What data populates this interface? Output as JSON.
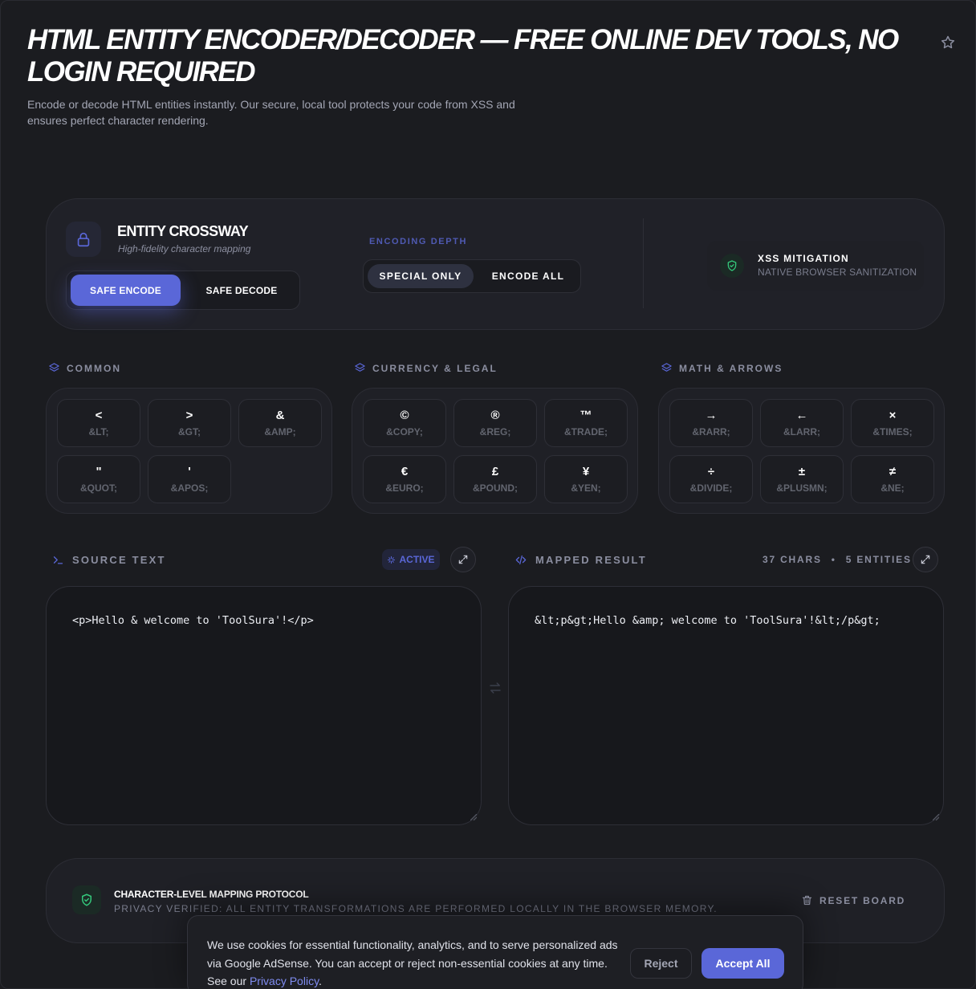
{
  "header": {
    "title": "HTML ENTITY ENCODER/DECODER — FREE ONLINE DEV TOOLS, NO LOGIN REQUIRED",
    "subtitle": "Encode or decode HTML entities instantly. Our secure, local tool protects your code from XSS and ensures perfect character rendering."
  },
  "panel": {
    "brand_name": "ENTITY CROSSWAY",
    "brand_tagline": "High-fidelity character mapping",
    "mode": {
      "encode_label": "SAFE ENCODE",
      "decode_label": "SAFE DECODE",
      "active": "encode"
    },
    "depth": {
      "label": "ENCODING DEPTH",
      "special_label": "SPECIAL ONLY",
      "all_label": "ENCODE ALL",
      "active": "special"
    },
    "xss": {
      "title": "XSS MITIGATION",
      "subtitle": "NATIVE BROWSER SANITIZATION"
    }
  },
  "categories": [
    {
      "label": "COMMON",
      "entities": [
        {
          "char": "<",
          "code": "&LT;"
        },
        {
          "char": ">",
          "code": "&GT;"
        },
        {
          "char": "&",
          "code": "&AMP;"
        },
        {
          "char": "\"",
          "code": "&QUOT;"
        },
        {
          "char": "'",
          "code": "&APOS;"
        }
      ]
    },
    {
      "label": "CURRENCY & LEGAL",
      "entities": [
        {
          "char": "©",
          "code": "&COPY;"
        },
        {
          "char": "®",
          "code": "&REG;"
        },
        {
          "char": "™",
          "code": "&TRADE;"
        },
        {
          "char": "€",
          "code": "&EURO;"
        },
        {
          "char": "£",
          "code": "&POUND;"
        },
        {
          "char": "¥",
          "code": "&YEN;"
        }
      ]
    },
    {
      "label": "MATH & ARROWS",
      "entities": [
        {
          "char": "→",
          "code": "&RARR;"
        },
        {
          "char": "←",
          "code": "&LARR;"
        },
        {
          "char": "×",
          "code": "&TIMES;"
        },
        {
          "char": "÷",
          "code": "&DIVIDE;"
        },
        {
          "char": "±",
          "code": "&PLUSMN;"
        },
        {
          "char": "≠",
          "code": "&NE;"
        }
      ]
    }
  ],
  "source": {
    "label": "SOURCE TEXT",
    "badge": "ACTIVE",
    "value": "<p>Hello & welcome to 'ToolSura'!</p>"
  },
  "result": {
    "label": "MAPPED RESULT",
    "chars": "37 CHARS",
    "separator": "•",
    "entities": "5 ENTITIES",
    "value": "&lt;p&gt;Hello &amp; welcome to 'ToolSura'!&lt;/p&gt;"
  },
  "protocol": {
    "title": "CHARACTER-LEVEL MAPPING PROTOCOL",
    "subtitle": "PRIVACY VERIFIED: ALL ENTITY TRANSFORMATIONS ARE PERFORMED LOCALLY IN THE BROWSER MEMORY.",
    "reset_label": "RESET BOARD"
  },
  "cookie": {
    "text": "We use cookies for essential functionality, analytics, and to serve personalized ads via Google AdSense. You can accept or reject non-essential cookies at any time. See our ",
    "link_text": "Privacy Policy",
    "text_end": ".",
    "reject_label": "Reject",
    "accept_label": "Accept All"
  },
  "colors": {
    "background": "#1b1c20",
    "accent": "#5a67d8",
    "success": "#34c77b"
  },
  "icons": {
    "favorite": "star-icon",
    "brand": "lock-icon",
    "xss": "shield-check-icon",
    "category": "layers-icon",
    "source": "terminal-icon",
    "active": "sparkle-icon",
    "expand": "expand-icon",
    "result": "code-icon",
    "swap": "swap-icon",
    "reset": "trash-icon"
  }
}
